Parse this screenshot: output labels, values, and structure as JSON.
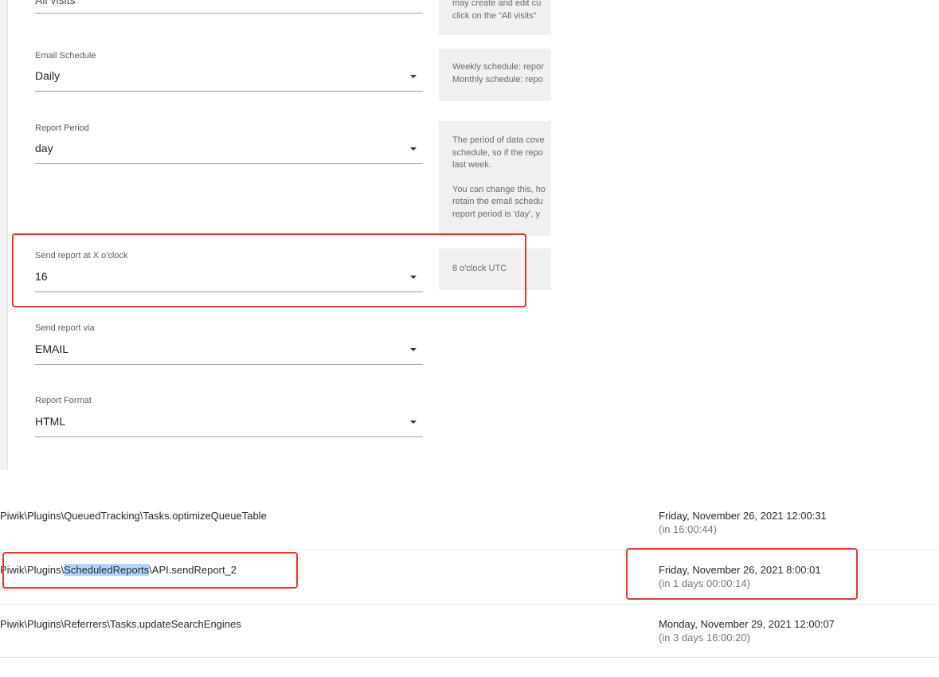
{
  "form": {
    "top_field": {
      "value": "All visits"
    },
    "fields": [
      {
        "label": "Email Schedule",
        "value": "Daily"
      },
      {
        "label": "Report Period",
        "value": "day"
      },
      {
        "label": "Send report at X o'clock",
        "value": "16"
      },
      {
        "label": "Send report via",
        "value": "EMAIL"
      },
      {
        "label": "Report Format",
        "value": "HTML"
      }
    ],
    "help": {
      "segment": [
        "may create and edit cu",
        "click on the \"All visits\""
      ],
      "schedule": [
        "Weekly schedule: repor",
        "Monthly schedule: repo"
      ],
      "period_p1": [
        "The period of data cove",
        "schedule, so if the repo",
        "last week."
      ],
      "period_p2": [
        "You can change this, ho",
        "retain the email schedu",
        "report period is 'day', y"
      ],
      "hour": [
        "8 o'clock UTC"
      ]
    }
  },
  "tasks": [
    {
      "name": "Piwik\\Plugins\\QueuedTracking\\Tasks.optimizeQueueTable",
      "date": "Friday, November 26, 2021 12:00:31",
      "relative": "(in 16:00:44)"
    },
    {
      "name_prefix": "Piwik\\Plugins\\",
      "name_selected": "ScheduledReports",
      "name_suffix": "\\API.sendReport_2",
      "date": "Friday, November 26, 2021 8:00:01",
      "relative": "(in 1 days 00:00:14)"
    },
    {
      "name": "Piwik\\Plugins\\Referrers\\Tasks.updateSearchEngines",
      "date": "Monday, November 29, 2021 12:00:07",
      "relative": "(in 3 days 16:00:20)"
    }
  ],
  "colors": {
    "highlight": "#e03a30",
    "selection": "#b3d4fc",
    "help_bg": "#f0f0f0"
  }
}
